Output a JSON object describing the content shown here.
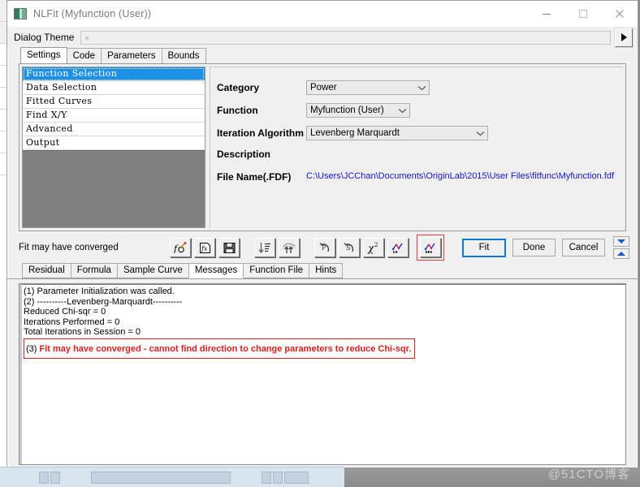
{
  "window": {
    "title": "NLFit (Myfunction (User))",
    "icon": "app-icon",
    "controls": {
      "minimize": "minimize-icon",
      "maximize": "maximize-icon",
      "close": "close-icon"
    }
  },
  "theme": {
    "label": "Dialog Theme",
    "value": "×",
    "placeholder": "",
    "arrow_icon": "play-arrow-icon"
  },
  "tabs": [
    {
      "label": "Settings",
      "active": true
    },
    {
      "label": "Code",
      "active": false
    },
    {
      "label": "Parameters",
      "active": false
    },
    {
      "label": "Bounds",
      "active": false
    }
  ],
  "tree": [
    {
      "label": "Function Selection",
      "selected": true
    },
    {
      "label": "Data Selection",
      "selected": false
    },
    {
      "label": "Fitted Curves",
      "selected": false
    },
    {
      "label": "Find X/Y",
      "selected": false
    },
    {
      "label": "Advanced",
      "selected": false
    },
    {
      "label": "Output",
      "selected": false
    }
  ],
  "form": {
    "category_label": "Category",
    "category_value": "Power",
    "function_label": "Function",
    "function_value": "Myfunction (User)",
    "iteration_label": "Iteration Algorithm",
    "iteration_value": "Levenberg Marquardt",
    "description_label": "Description",
    "description_value": "",
    "file_label": "File Name(.FDF)",
    "file_value": "C:\\Users\\JCChan\\Documents\\OriginLab\\2015\\User Files\\fitfunc\\Myfunction.fdf",
    "link_color": "#1414d2"
  },
  "status": {
    "text": "Fit may have converged"
  },
  "toolbar": [
    {
      "name": "initialize-parameters-button",
      "glyph": "f(x)-pencil-icon"
    },
    {
      "name": "fit-function-file-button",
      "glyph": "fx-document-icon"
    },
    {
      "name": "save-button",
      "glyph": "floppy-disk-icon"
    },
    {
      "name": "sort-descending-button",
      "glyph": "sort-down-icon"
    },
    {
      "name": "approximate-button",
      "glyph": "curve-up-arrows-icon"
    },
    {
      "name": "undo-button",
      "glyph": "undo-p-icon"
    },
    {
      "name": "reset-button",
      "glyph": "undo-s-icon"
    },
    {
      "name": "chi-square-button",
      "glyph": "chi-squared-icon"
    },
    {
      "name": "one-iteration-button",
      "glyph": "fit-one-step-icon"
    },
    {
      "name": "fit-until-converged-button",
      "glyph": "fit-to-end-icon",
      "highlighted": true
    }
  ],
  "highlight_color": "#e83a3a",
  "buttons": {
    "fit": "Fit",
    "done": "Done",
    "cancel": "Cancel",
    "nav_down": "chevron-down-icon",
    "nav_up": "chevron-up-icon"
  },
  "bottom_tabs": [
    {
      "label": "Residual",
      "active": false
    },
    {
      "label": "Formula",
      "active": false
    },
    {
      "label": "Sample Curve",
      "active": false
    },
    {
      "label": "Messages",
      "active": true
    },
    {
      "label": "Function File",
      "active": false
    },
    {
      "label": "Hints",
      "active": false
    }
  ],
  "messages": {
    "lines": [
      "(1) Parameter Initialization was called.",
      "(2) ----------Levenberg-Marquardt----------",
      "Reduced Chi-sqr = 0",
      "Iterations Performed = 0",
      "Total Iterations in Session = 0"
    ],
    "highlight_index": "(3) ",
    "highlight_text": "Fit may have converged - cannot find direction to change parameters to reduce Chi-sqr.",
    "highlight_color": "#e01b1b"
  },
  "watermark": "@51CTO博客"
}
